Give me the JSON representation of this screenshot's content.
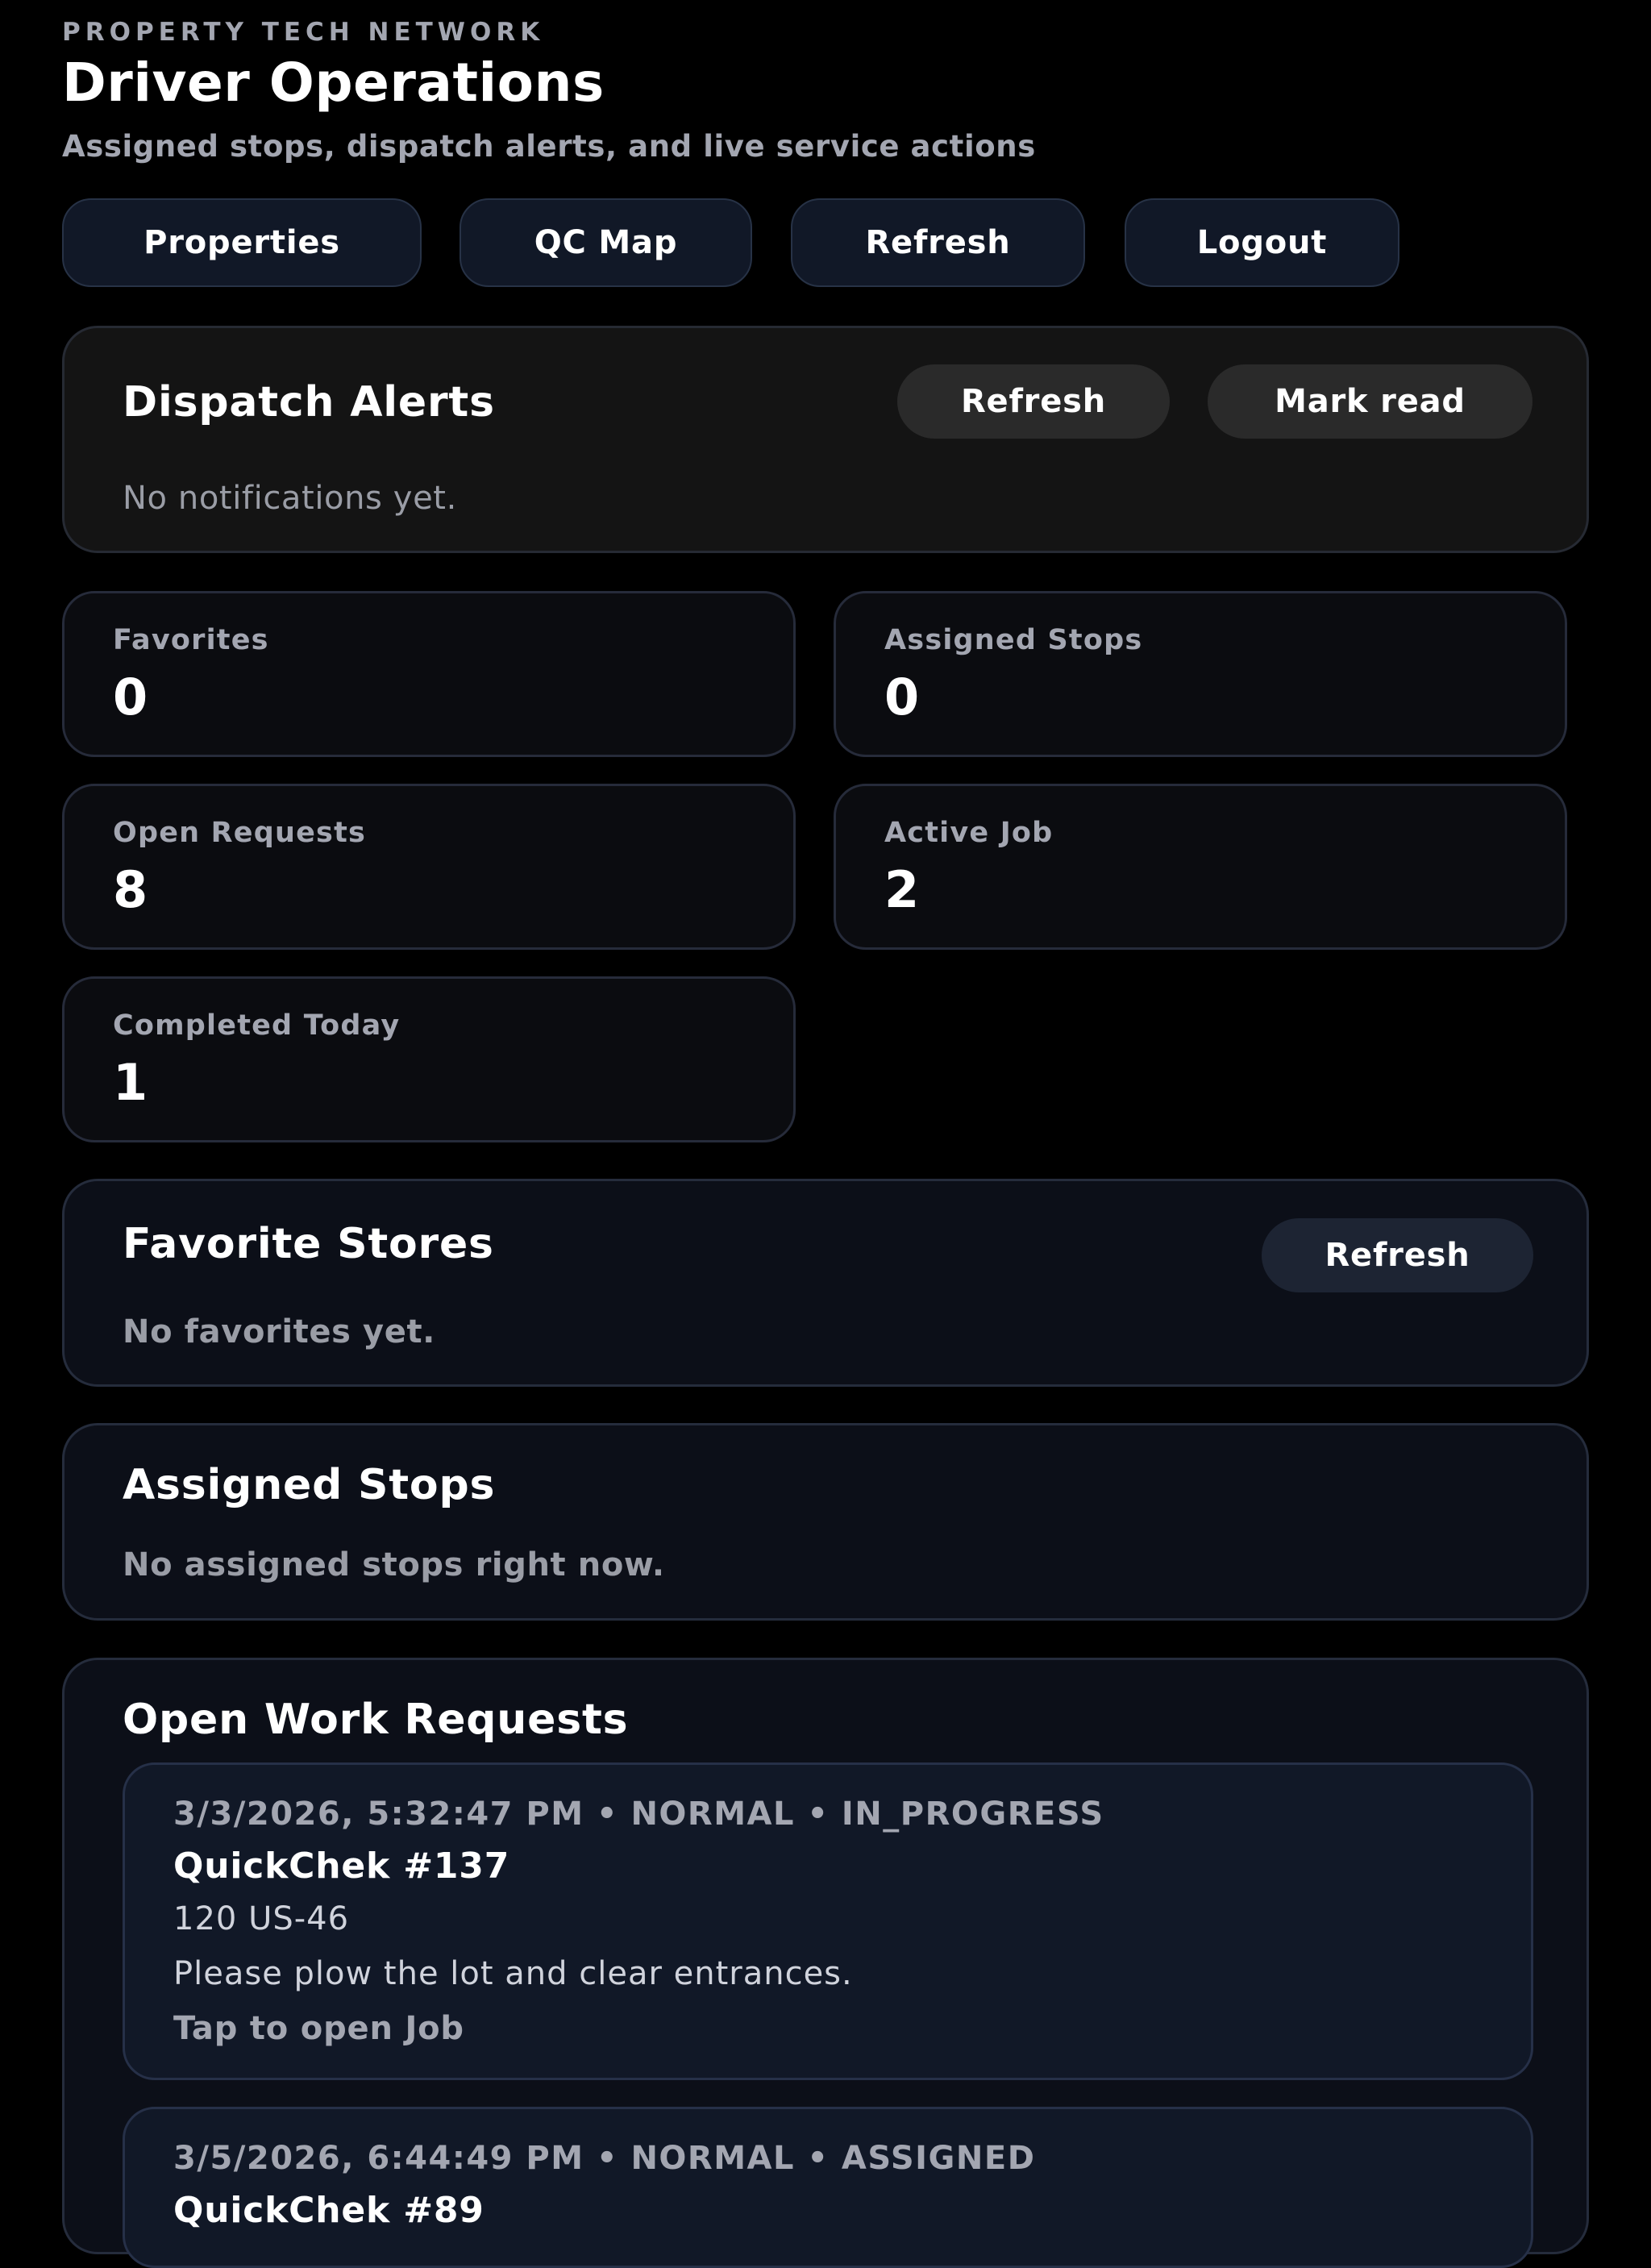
{
  "header": {
    "eyebrow": "PROPERTY TECH NETWORK",
    "title": "Driver Operations",
    "subtitle": "Assigned stops, dispatch alerts, and live service actions"
  },
  "nav": {
    "properties": "Properties",
    "qc_map": "QC Map",
    "refresh": "Refresh",
    "logout": "Logout"
  },
  "alerts": {
    "title": "Dispatch Alerts",
    "refresh_label": "Refresh",
    "mark_read_label": "Mark read",
    "empty_text": "No notifications yet."
  },
  "stats": [
    {
      "label": "Favorites",
      "value": "0"
    },
    {
      "label": "Assigned Stops",
      "value": "0"
    },
    {
      "label": "Open Requests",
      "value": "8"
    },
    {
      "label": "Active Job",
      "value": "2"
    },
    {
      "label": "Completed Today",
      "value": "1"
    }
  ],
  "favorites": {
    "title": "Favorite Stores",
    "refresh_label": "Refresh",
    "empty_text": "No favorites yet."
  },
  "assigned": {
    "title": "Assigned Stops",
    "empty_text": "No assigned stops right now."
  },
  "requests": {
    "title": "Open Work Requests",
    "items": [
      {
        "meta": "3/3/2026, 5:32:47 PM • NORMAL • IN_PROGRESS",
        "name": "QuickChek #137",
        "address": "120 US-46",
        "note": "Please plow the lot and clear entrances.",
        "link": "Tap to open Job"
      },
      {
        "meta": "3/5/2026, 6:44:49 PM • NORMAL • ASSIGNED",
        "name": "QuickChek #89"
      }
    ]
  },
  "colors": {
    "background": "#000000",
    "card": "#0c0f18",
    "alerts_card": "#141414",
    "muted_text": "#a3a6b1",
    "nav_button": "#111827"
  }
}
